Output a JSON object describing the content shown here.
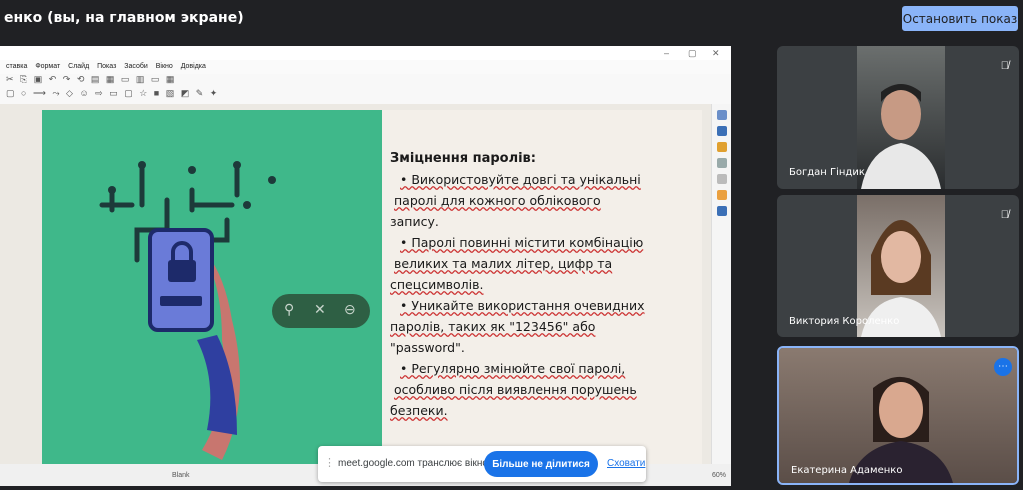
{
  "topbar": {
    "title": "енко (вы, на главном экране)",
    "stop_label": "Остановить показ"
  },
  "window": {
    "menu": [
      "ставка",
      "Формат",
      "Слайд",
      "Показ",
      "Засоби",
      "Вікно",
      "Довідка"
    ],
    "controls": [
      "–",
      "▢",
      "✕"
    ],
    "status": {
      "layout": "Blank",
      "zoom": "60%"
    }
  },
  "slide": {
    "heading": "Зміцнення паролів:",
    "lines": [
      "• Використовуйте довгі та унікальні",
      "паролі для кожного облікового",
      "запису.",
      "• Паролі повинні містити комбінацію",
      "великих та малих літер, цифр та",
      "спецсимволів.",
      "• Уникайте використання очевидних",
      "паролів, таких як \"123456\" або",
      "\"password\".",
      "• Регулярно змінюйте свої паролі,",
      "особливо після виявлення порушень",
      "безпеки."
    ]
  },
  "share_bar": {
    "message": "meet.google.com транслює вікно.",
    "stop_label": "Більше не ділитися",
    "hide_label": "Сховати"
  },
  "participants": [
    {
      "name": "Богдан Гіндик"
    },
    {
      "name": "Виктория Короленко"
    },
    {
      "name": "Екатерина Адаменко"
    }
  ],
  "colors": {
    "accent": "#8ab4f8",
    "slide_green": "#3fb88a",
    "meet_blue": "#1a73e8"
  }
}
